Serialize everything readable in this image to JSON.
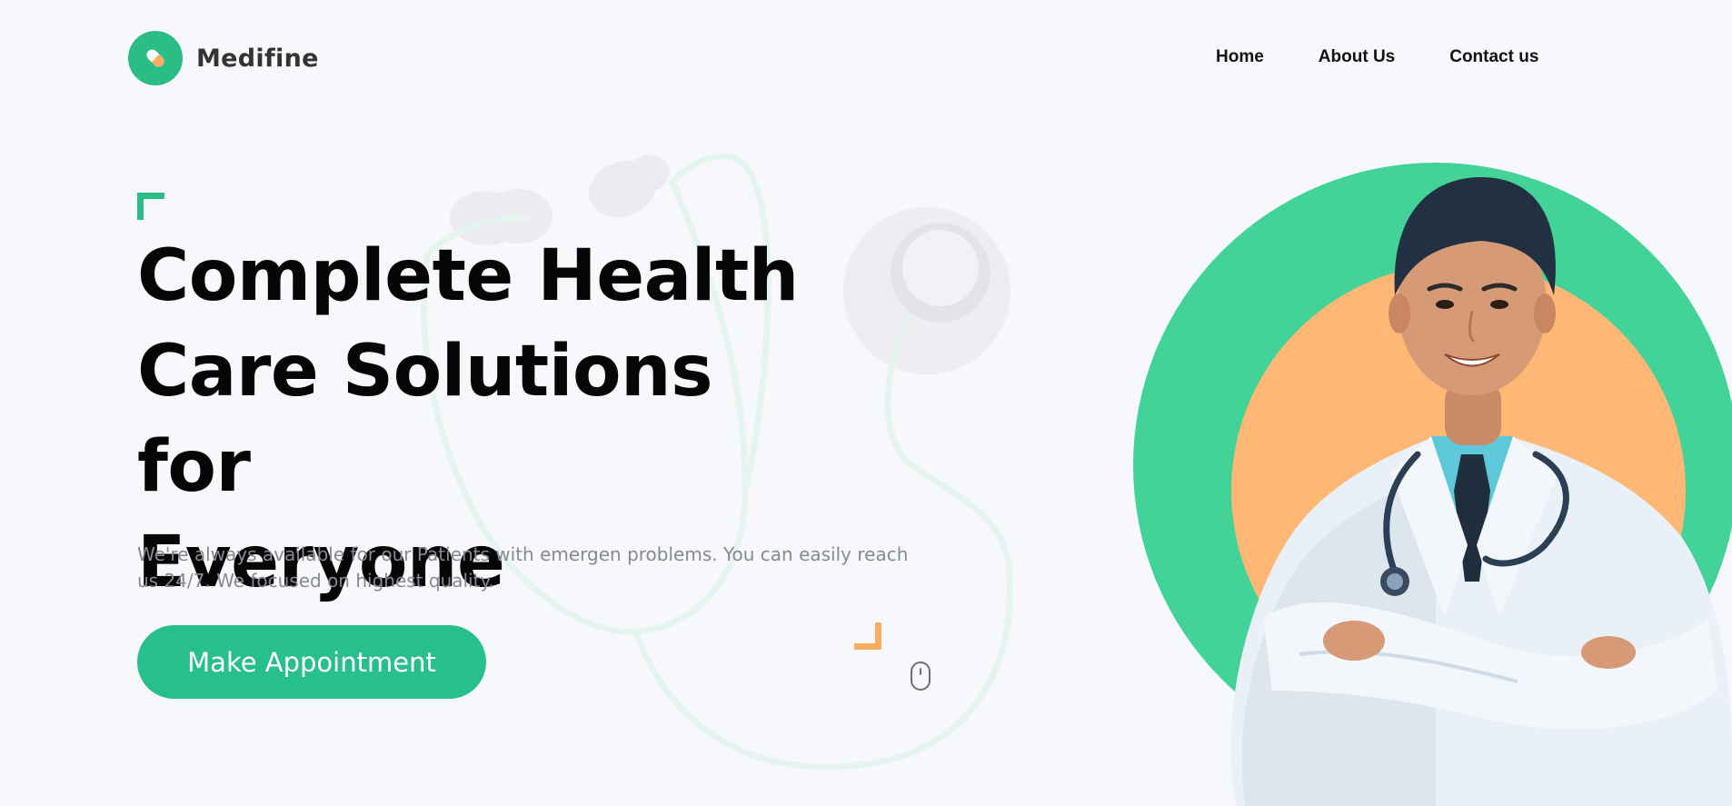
{
  "brand": {
    "name": "Medifine"
  },
  "nav": {
    "items": [
      {
        "label": "Home"
      },
      {
        "label": "About Us"
      },
      {
        "label": "Contact us"
      }
    ]
  },
  "hero": {
    "headline_lines": [
      "Complete Health",
      "Care Solutions for",
      "Everyone"
    ],
    "description": "We're always available for our Patients with emergen problems. You can easily reach us 24/7. We focused on highest quality.",
    "cta_label": "Make Appointment"
  },
  "colors": {
    "brand_green": "#2bbd86",
    "accent_orange": "#f9ad5e",
    "ring_green": "#43d398",
    "ring_orange": "#ffb775",
    "background": "#f7f8fc"
  },
  "icons": {
    "logo": "pill-icon",
    "scroll": "mouse-scroll-icon"
  }
}
